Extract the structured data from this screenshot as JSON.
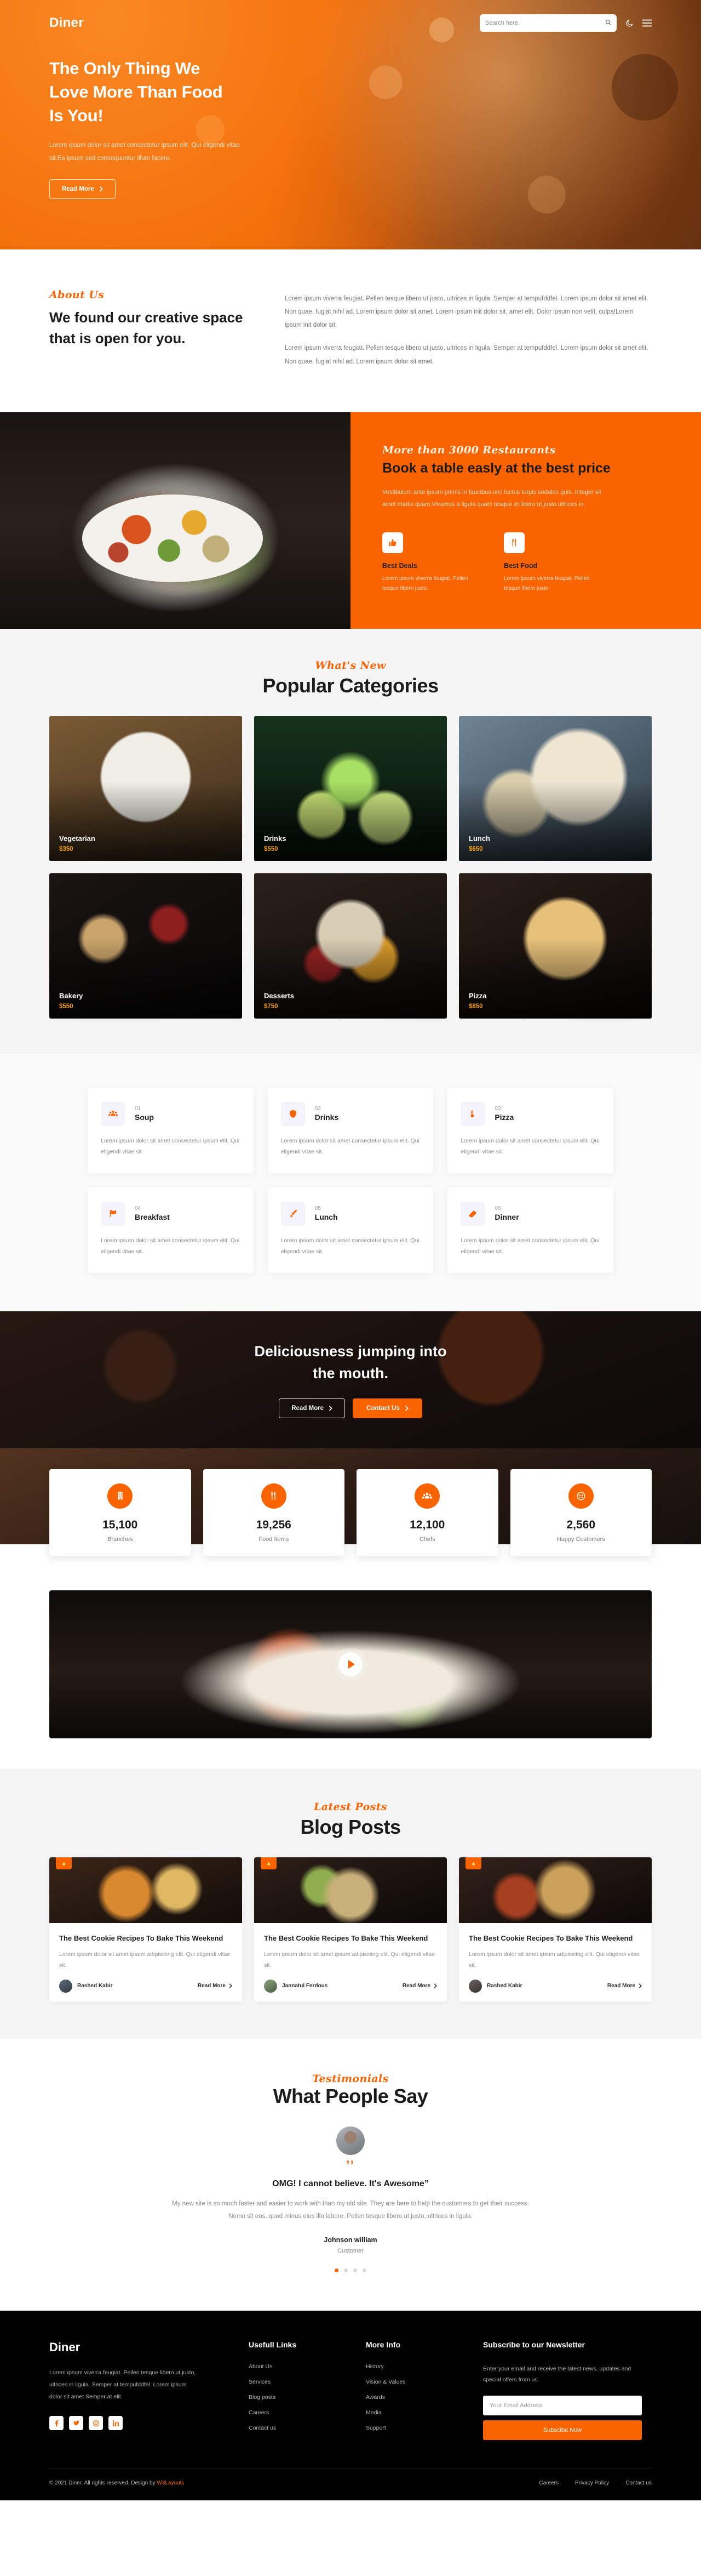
{
  "header": {
    "logo": "Diner",
    "search_placeholder": "Search here.",
    "search_value": "",
    "icons": {
      "search": "search-icon",
      "theme": "moon-icon",
      "menu": "hamburger-icon"
    }
  },
  "hero": {
    "title_line1": "The Only Thing We",
    "title_line2": "Love More Than Food",
    "title_line3": "Is You!",
    "paragraph": "Lorem ipsum dolor sit amet consectetur ipsum elit. Qui eligendi vitae sit.Ea ipsum sed consequuntur illum facere.",
    "cta": "Read More"
  },
  "about": {
    "label": "About Us",
    "title": "We found our creative space that is open for you.",
    "paragraph1": "Lorem ipsum viverra feugiat. Pellen tesque libero ut justo, ultrices in ligula. Semper at tempufddfel. Lorem ipsum dolor sit amet elit. Non quae, fugiat nihil ad. Lorem ipsum dolor sit amet. Lorem ipsum init dolor sit, amet elit. Dolor ipsum non velit, culpa!Lorem ipsum init dolor sit.",
    "paragraph2": "Lorem ipsum viverra feugiat. Pellen tesque libero ut justo, ultrices in ligula. Semper at tempufddfel. Lorem ipsum dolor sit amet elit. Non quae, fugiat nihil ad. Lorem ipsum dolor sit amet."
  },
  "book": {
    "label": "More than 3000 Restaurants",
    "title": "Book a table easly at the best price",
    "paragraph": "Vestibulum ante ipsum primis in faucibus orci luctus turpis sodales quis. Integer sit amet mattis quam.Vivamus a ligula quam tesque et libero ut justo ultrices in.",
    "features": [
      {
        "icon": "thumbs-up-icon",
        "glyph": "👍",
        "title": "Best Deals",
        "desc": "Lorem ipsum viverra feugiat. Pellen tesque libero justo."
      },
      {
        "icon": "cutlery-icon",
        "glyph": "🍴",
        "title": "Best Food",
        "desc": "Lorem ipsum viverra feugiat. Pellen tesque libero justo."
      }
    ]
  },
  "categories": {
    "label": "What's New",
    "title": "Popular Categories",
    "items": [
      {
        "name": "Vegetarian",
        "price": "$350",
        "art": "ph-veg"
      },
      {
        "name": "Drinks",
        "price": "$550",
        "art": "ph-drink"
      },
      {
        "name": "Lunch",
        "price": "$650",
        "art": "ph-lunch"
      },
      {
        "name": "Bakery",
        "price": "$550",
        "art": "ph-bakery"
      },
      {
        "name": "Desserts",
        "price": "$750",
        "art": "ph-dess"
      },
      {
        "name": "Pizza",
        "price": "$850",
        "art": "ph-pizza"
      }
    ]
  },
  "menu": {
    "items": [
      {
        "num": "01",
        "name": "Soup",
        "icon": "group-icon",
        "glyph": "👥",
        "desc": "Lorem ipsum dolor sit amet consectetur ipsum elit. Qui eligendi vitae sit."
      },
      {
        "num": "02",
        "name": "Drinks",
        "icon": "shield-icon",
        "glyph": "🛡",
        "desc": "Lorem ipsum dolor sit amet consectetur ipsum elit. Qui eligendi vitae sit."
      },
      {
        "num": "03",
        "name": "Pizza",
        "icon": "thermometer-icon",
        "glyph": "🌡",
        "desc": "Lorem ipsum dolor sit amet consectetur ipsum elit. Qui eligendi vitae sit."
      },
      {
        "num": "04",
        "name": "Breakfast",
        "icon": "flag-icon",
        "glyph": "🚩",
        "desc": "Lorem ipsum dolor sit amet consectetur ipsum elit. Qui eligendi vitae sit."
      },
      {
        "num": "05",
        "name": "Lunch",
        "icon": "brush-icon",
        "glyph": "🖌",
        "desc": "Lorem ipsum dolor sit amet consectetur ipsum elit. Qui eligendi vitae sit."
      },
      {
        "num": "06",
        "name": "Dinner",
        "icon": "eraser-icon",
        "glyph": "🧽",
        "desc": "Lorem ipsum dolor sit amet consectetur ipsum elit. Qui eligendi vitae sit."
      }
    ]
  },
  "delicious": {
    "title_line1": "Deliciousness jumping into",
    "title_line2": "the mouth.",
    "btn_secondary": "Read More",
    "btn_primary": "Contact Us"
  },
  "stats": [
    {
      "icon": "building-icon",
      "glyph": "🏢",
      "value": "15,100",
      "label": "Branches"
    },
    {
      "icon": "cutlery-icon",
      "glyph": "🍴",
      "value": "19,256",
      "label": "Food Items"
    },
    {
      "icon": "chefs-icon",
      "glyph": "👥",
      "value": "12,100",
      "label": "Chefs"
    },
    {
      "icon": "smile-icon",
      "glyph": "☺",
      "value": "2,560",
      "label": "Happy Customers"
    }
  ],
  "video": {
    "play": "play-button"
  },
  "blog": {
    "label": "Latest Posts",
    "title": "Blog Posts",
    "posts": [
      {
        "badge": "🔥",
        "title": "The Best Cookie Recipes To Bake This Weekend",
        "excerpt": "Lorem ipsum dolor sit amet ipsum adipisicing elit. Qui eligendi vitae sit.",
        "author": "Rashed Kabir",
        "read_more": "Read More",
        "art": "bi1",
        "av": "av1"
      },
      {
        "badge": "🔥",
        "title": "The Best Cookie Recipes To Bake This Weekend",
        "excerpt": "Lorem ipsum dolor sit amet ipsum adipisicing elit. Qui eligendi vitae sit.",
        "author": "Jannatul Ferdous",
        "read_more": "Read More",
        "art": "bi2",
        "av": "av2"
      },
      {
        "badge": "🔥",
        "title": "The Best Cookie Recipes To Bake This Weekend",
        "excerpt": "Lorem ipsum dolor sit amet ipsum adipisicing elit. Qui eligendi vitae sit.",
        "author": "Rashed Kabir",
        "read_more": "Read More",
        "art": "bi3",
        "av": "av3"
      }
    ]
  },
  "testimonial": {
    "label": "Testimonials",
    "title": "What People Say",
    "quote_mark": "’’",
    "headline": "OMG! I cannot believe. It's Awesome”",
    "body": "My new site is so much faster and easier to work with than my old site. They are here to help the customers to get their success. Nemo sit eos, quod minus eius illo labore. Pellen tesque libero ut justo, ultrices in ligula.",
    "name": "Johnson william",
    "role": "Customer",
    "dots": 4,
    "active_dot": 0
  },
  "footer": {
    "logo": "Diner",
    "about": "Lorem ipsum viverra feugiat. Pellen tesque libero ut justo, ultrices in ligula. Semper at tempufddfel. Lorem ipsum dolor sit amet Semper at elit.",
    "socials": [
      {
        "name": "facebook-icon",
        "glyph": "f"
      },
      {
        "name": "twitter-icon",
        "glyph": "𝑭"
      },
      {
        "name": "instagram-icon",
        "glyph": "◎"
      },
      {
        "name": "linkedin-icon",
        "glyph": "in"
      }
    ],
    "col_useful": {
      "heading": "Usefull Links",
      "items": [
        "About Us",
        "Services",
        "Blog posts",
        "Careers",
        "Contact us"
      ]
    },
    "col_more": {
      "heading": "More Info",
      "items": [
        "History",
        "Vision & Values",
        "Awards",
        "Media",
        "Support"
      ]
    },
    "newsletter": {
      "heading": "Subscribe to our Newsletter",
      "desc": "Enter your email and receive the latest news, updates and special offers from us.",
      "placeholder": "Your Email Address",
      "value": "",
      "button": "Subscibe Now"
    },
    "copyright": "© 2021 Diner. All rights reserved. Design by ",
    "designer": "W3Layouts",
    "bottom_links": [
      "Careers",
      "Privacy Policy",
      "Contact us"
    ]
  },
  "colors": {
    "accent": "#f96300",
    "dark": "#000000",
    "price": "#f7a000"
  }
}
